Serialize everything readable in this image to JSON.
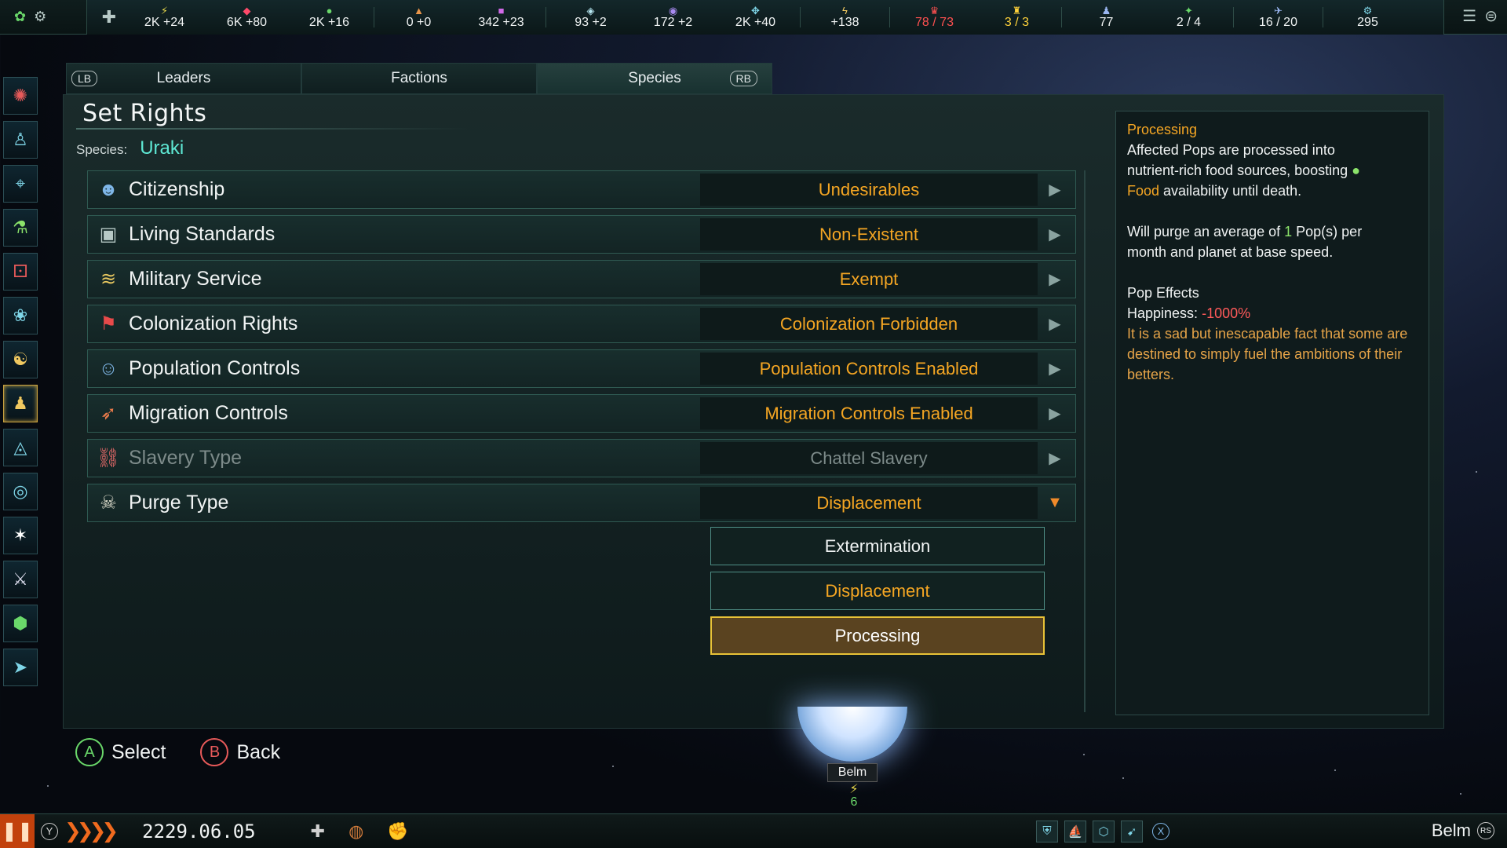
{
  "topbar": {
    "resources": [
      {
        "icon": "⚡",
        "icon_name": "energy-icon",
        "value": "2K +24",
        "color": "#e8d84a"
      },
      {
        "icon": "◆",
        "icon_name": "minerals-icon",
        "value": "6K +80",
        "color": "#ff4a6a"
      },
      {
        "icon": "●",
        "icon_name": "food-icon",
        "value": "2K +16",
        "color": "#6ad86a"
      },
      {
        "icon": "▲",
        "icon_name": "consumer-goods-icon",
        "value": "0 +0",
        "color": "#e8954a"
      },
      {
        "icon": "■",
        "icon_name": "alloys-icon",
        "value": "342 +23",
        "color": "#d06ae8"
      },
      {
        "icon": "◈",
        "icon_name": "influence-icon",
        "value": "93 +2",
        "color": "#b6e6f0"
      },
      {
        "icon": "◉",
        "icon_name": "unity-icon",
        "value": "172 +2",
        "color": "#a88af0"
      },
      {
        "icon": "✥",
        "icon_name": "research-icon",
        "value": "2K +40",
        "color": "#7fd6e8"
      },
      {
        "icon": "ϟ",
        "icon_name": "rare-resource-icon",
        "value": "+138",
        "color": "#f0c860"
      },
      {
        "icon": "♛",
        "icon_name": "empire-size-icon",
        "value": "78 / 73",
        "color": "#ff5050",
        "alert": "red"
      },
      {
        "icon": "♜",
        "icon_name": "planets-icon",
        "value": "3 / 3",
        "color": "#ffd23a",
        "alert": "yellow"
      },
      {
        "icon": "♟",
        "icon_name": "pops-icon",
        "value": "77",
        "color": "#9ab6f0"
      },
      {
        "icon": "✦",
        "icon_name": "starbase-icon",
        "value": "2 / 4",
        "color": "#6ad86a"
      },
      {
        "icon": "✈",
        "icon_name": "naval-capacity-icon",
        "value": "16 / 20",
        "color": "#9ab6f0"
      },
      {
        "icon": "⚙",
        "icon_name": "fleet-power-icon",
        "value": "295",
        "color": "#7fd6e8"
      }
    ]
  },
  "tabs": {
    "lb": "LB",
    "rb": "RB",
    "items": [
      "Leaders",
      "Factions",
      "Species"
    ]
  },
  "panel": {
    "title": "Set Rights",
    "species_label": "Species:",
    "species_name": "Uraki"
  },
  "rights": [
    {
      "label": "Citizenship",
      "value": "Undesirables",
      "icon": "☻",
      "icon_name": "citizenship-icon"
    },
    {
      "label": "Living Standards",
      "value": "Non-Existent",
      "icon": "▣",
      "icon_name": "living-standards-icon"
    },
    {
      "label": "Military Service",
      "value": "Exempt",
      "icon": "≋",
      "icon_name": "military-service-icon"
    },
    {
      "label": "Colonization Rights",
      "value": "Colonization Forbidden",
      "icon": "⚑",
      "icon_name": "colonization-flag-icon"
    },
    {
      "label": "Population Controls",
      "value": "Population Controls Enabled",
      "icon": "☺",
      "icon_name": "population-controls-icon"
    },
    {
      "label": "Migration Controls",
      "value": "Migration Controls Enabled",
      "icon": "➶",
      "icon_name": "migration-controls-icon"
    },
    {
      "label": "Slavery Type",
      "value": "Chattel Slavery",
      "icon": "⛓",
      "icon_name": "slavery-chain-icon"
    },
    {
      "label": "Purge Type",
      "value": "Displacement",
      "icon": "☠",
      "icon_name": "skull-icon"
    }
  ],
  "purge_options": [
    "Extermination",
    "Displacement",
    "Processing"
  ],
  "tooltip": {
    "title": "Processing",
    "line1a": "Affected Pops are processed into",
    "line1b": "nutrient-rich food sources, boosting",
    "food": "Food",
    "line1c": "availability until death.",
    "line2a": "Will purge an average of",
    "line2num": "1",
    "line2b": "Pop(s) per",
    "line2c": "month and planet at base speed.",
    "pop_effects": "Pop Effects",
    "happiness_label": "Happiness:",
    "happiness_value": "-1000%",
    "flavor": "It is a sad but inescapable fact that some are destined to simply fuel the ambitions of their betters."
  },
  "hints": {
    "a_key": "A",
    "a_label": "Select",
    "b_key": "B",
    "b_label": "Back"
  },
  "planet": {
    "name": "Belm",
    "energy": "6"
  },
  "bottombar": {
    "y_key": "Y",
    "x_key": "X",
    "rs_key": "RS",
    "date": "2229.06.05",
    "location": "Belm"
  }
}
